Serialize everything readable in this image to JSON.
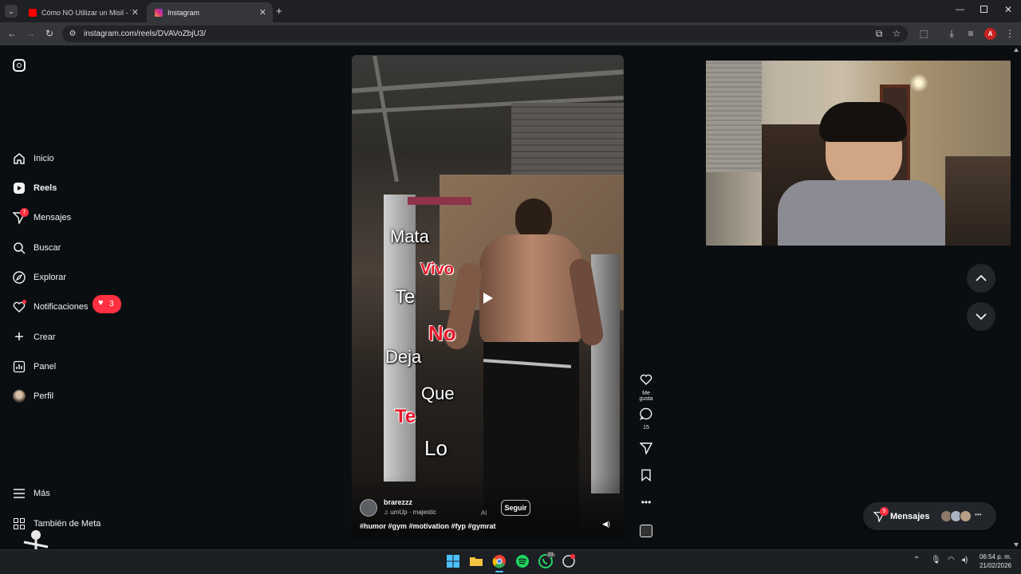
{
  "browser": {
    "tabs": [
      {
        "title": "Cómo NO Utilizar un Misil - Yo",
        "active": false
      },
      {
        "title": "Instagram",
        "active": true
      }
    ],
    "url": "instagram.com/reels/DVAVoZbjU3/",
    "profile_initial": "A"
  },
  "sidebar": {
    "items": [
      {
        "label": "Inicio",
        "icon": "home-icon"
      },
      {
        "label": "Reels",
        "icon": "reels-icon"
      },
      {
        "label": "Mensajes",
        "icon": "messages-icon",
        "badge": "7"
      },
      {
        "label": "Buscar",
        "icon": "search-icon"
      },
      {
        "label": "Explorar",
        "icon": "compass-icon"
      },
      {
        "label": "Notificaciones",
        "icon": "heart-icon",
        "pill": "3"
      },
      {
        "label": "Crear",
        "icon": "plus-icon"
      },
      {
        "label": "Panel",
        "icon": "chart-icon"
      },
      {
        "label": "Perfil",
        "icon": "avatar-icon"
      },
      {
        "label": "Más",
        "icon": "menu-icon"
      },
      {
        "label": "También de Meta",
        "icon": "grid-icon"
      }
    ]
  },
  "reel": {
    "caption_words": [
      {
        "text": "Mata",
        "red": false
      },
      {
        "text": "Vivo",
        "red": true
      },
      {
        "text": "Te",
        "red": false
      },
      {
        "text": "No",
        "red": true
      },
      {
        "text": "Deja",
        "red": false
      },
      {
        "text": "Que",
        "red": false
      },
      {
        "text": "Te",
        "red": true
      },
      {
        "text": "Lo",
        "red": false
      }
    ],
    "username": "brarezzz",
    "audio": "umUp · majestic",
    "follow_label": "Seguir",
    "hashtags": "#humor #gym #motivation #fyp #gymrat",
    "ad_label": "Al"
  },
  "actions": {
    "like_label": "Me gusta",
    "comments_count": "15"
  },
  "messages_pill": {
    "label": "Mensajes",
    "badge": "5"
  },
  "taskbar": {
    "time": "06:54 p. m.",
    "date": "21/02/2026",
    "whatsapp_badge": "21"
  },
  "colors": {
    "accent_red": "#ff3040",
    "page_bg": "#0b0e11"
  }
}
